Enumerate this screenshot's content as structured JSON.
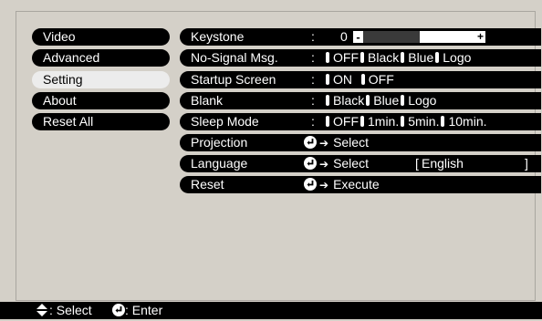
{
  "menu": {
    "items": [
      {
        "label": "Video",
        "selected": false
      },
      {
        "label": "Advanced",
        "selected": false
      },
      {
        "label": "Setting",
        "selected": true
      },
      {
        "label": "About",
        "selected": false
      },
      {
        "label": "Reset All",
        "selected": false
      }
    ]
  },
  "settings": {
    "colon": ":",
    "keystone": {
      "label": "Keystone",
      "value": "0",
      "level": 0.5,
      "minus": "-",
      "plus": "+"
    },
    "no_signal": {
      "label": "No-Signal Msg.",
      "options": [
        "OFF",
        "Black",
        "Blue",
        "Logo"
      ]
    },
    "startup": {
      "label": "Startup Screen",
      "options": [
        "ON",
        "OFF"
      ]
    },
    "blank": {
      "label": "Blank",
      "options": [
        "Black",
        "Blue",
        "Logo"
      ]
    },
    "sleep": {
      "label": "Sleep Mode",
      "options": [
        "OFF",
        "1min.",
        "5min.",
        "10min."
      ]
    },
    "projection": {
      "label": "Projection",
      "action": "Select"
    },
    "language": {
      "label": "Language",
      "action": "Select",
      "current": "English",
      "bracket_open": "[",
      "bracket_close": "]"
    },
    "reset": {
      "label": "Reset",
      "action": "Execute"
    }
  },
  "status_bar": {
    "select_text": ": Select",
    "enter_text": ": Enter"
  },
  "colors": {
    "background": "#d4d0c8",
    "item_bg": "#000000",
    "selected_bg": "#ececec",
    "text": "#ffffff"
  }
}
